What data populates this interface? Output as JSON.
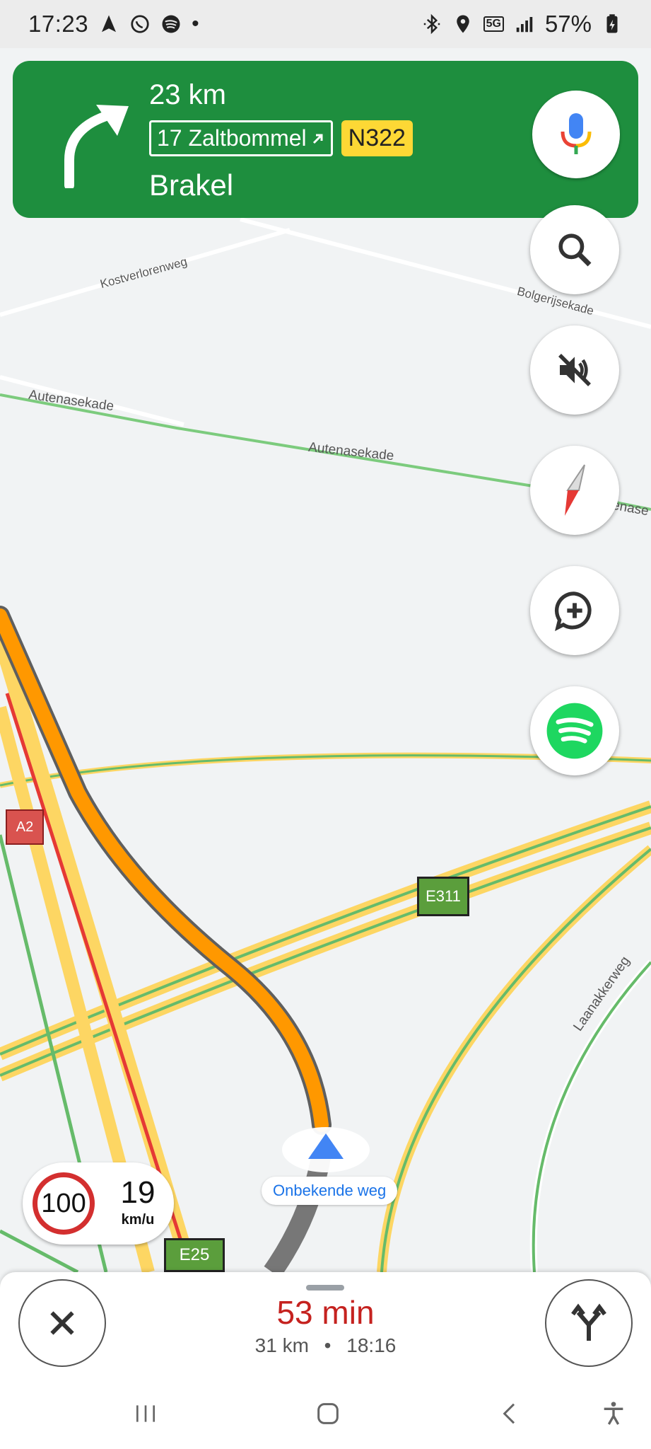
{
  "status_bar": {
    "time": "17:23",
    "battery": "57%",
    "network": "5G",
    "icons_left": [
      "navigation-icon",
      "whatsapp-icon",
      "spotify-icon",
      "dot-icon"
    ],
    "icons_right": [
      "bluetooth-icon",
      "location-icon",
      "5g-icon",
      "signal-icon",
      "battery-icon"
    ]
  },
  "guidance": {
    "distance": "23 km",
    "exit_sign": "17 Zaltbommel",
    "road_shield": "N322",
    "toward": "Brakel",
    "maneuver_icon": "turn-right-icon",
    "bg_color": "#1e8e3e"
  },
  "map": {
    "streets": [
      "Kostverlorenweg",
      "Bolgerijsekade",
      "Autenasekade",
      "Autenasekade",
      "enase",
      "Laanakkerweg"
    ],
    "shields": [
      "A2",
      "E311",
      "E25"
    ],
    "location_label": "Onbekende weg"
  },
  "speed": {
    "limit": "100",
    "current": "19",
    "unit": "km/u"
  },
  "trip": {
    "eta_minutes": "53 min",
    "distance": "31 km",
    "separator": "•",
    "arrival": "18:16"
  },
  "buttons": {
    "mic": "mic-icon",
    "search": "search-icon",
    "mute": "sound-off-icon",
    "compass": "compass-icon",
    "report": "add-report-icon",
    "spotify": "spotify-icon",
    "close": "close-icon",
    "alternate": "alternate-routes-icon"
  },
  "colors": {
    "route": "#ff9800",
    "traffic_heavy": "#e53935",
    "traffic_medium": "#fbc02d",
    "traffic_free": "#66bb6a",
    "eta": "#c5221f"
  }
}
